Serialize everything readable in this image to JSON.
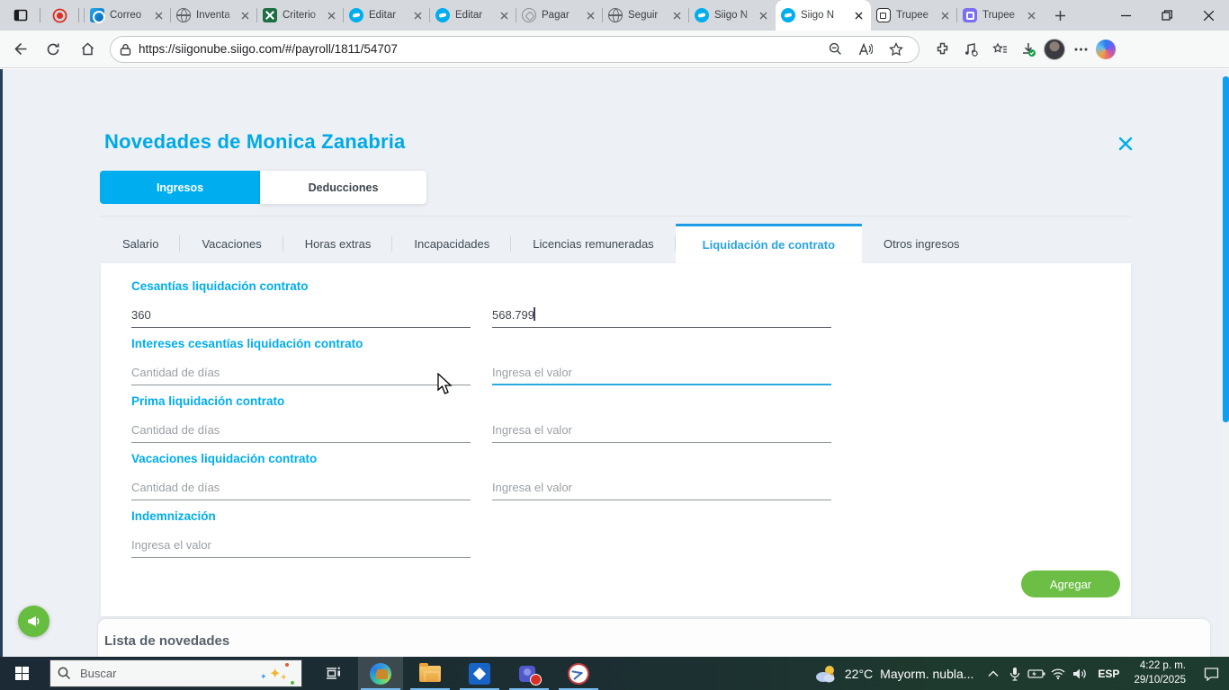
{
  "colors": {
    "accent_blue": "#00AEEF",
    "title_blue": "#00A9E6",
    "active_tab_blue": "#29a3e2",
    "green_button": "#6CBE45",
    "focus_underline": "#29ABE2",
    "taskbar_dark": "#1b2a35"
  },
  "browser": {
    "tabs": [
      {
        "label": "Correo",
        "icon": "outlook-favicon"
      },
      {
        "label": "Inventa",
        "icon": "globe-favicon"
      },
      {
        "label": "Criterio",
        "icon": "excel-favicon"
      },
      {
        "label": "Editar",
        "icon": "siigo-favicon"
      },
      {
        "label": "Editar",
        "icon": "siigo-favicon"
      },
      {
        "label": "Pagar",
        "icon": "chatgpt-favicon"
      },
      {
        "label": "Seguir",
        "icon": "globe-favicon"
      },
      {
        "label": "Siigo N",
        "icon": "siigo-favicon"
      },
      {
        "label": "Siigo N",
        "icon": "siigo-favicon",
        "active": true
      },
      {
        "label": "Trupee",
        "icon": "trupee-light-favicon"
      },
      {
        "label": "Trupee",
        "icon": "trupee-purple-favicon"
      }
    ],
    "url": "https://siigonube.siigo.com/#/payroll/1811/54707"
  },
  "modal": {
    "title": "Novedades de Monica Zanabria",
    "toggle": {
      "ingresos": "Ingresos",
      "deducciones": "Deducciones"
    },
    "tabs": [
      {
        "label": "Salario"
      },
      {
        "label": "Vacaciones"
      },
      {
        "label": "Horas extras"
      },
      {
        "label": "Incapacidades"
      },
      {
        "label": "Licencias remuneradas"
      },
      {
        "label": "Liquidación de contrato",
        "active": true
      },
      {
        "label": "Otros ingresos"
      }
    ],
    "sections": [
      {
        "label": "Cesantías liquidación contrato",
        "fields": [
          {
            "value": "360"
          },
          {
            "value": "568.799"
          }
        ]
      },
      {
        "label": "Intereses cesantías liquidación contrato",
        "fields": [
          {
            "placeholder": "Cantidad de días"
          },
          {
            "placeholder": "Ingresa el valor",
            "focused": true
          }
        ]
      },
      {
        "label": "Prima liquidación contrato",
        "fields": [
          {
            "placeholder": "Cantidad de días"
          },
          {
            "placeholder": "Ingresa el valor"
          }
        ]
      },
      {
        "label": "Vacaciones liquidación contrato",
        "fields": [
          {
            "placeholder": "Cantidad de días"
          },
          {
            "placeholder": "Ingresa el valor"
          }
        ]
      },
      {
        "label": "Indemnización",
        "fields": [
          {
            "placeholder": "Ingresa el valor"
          }
        ]
      }
    ],
    "add_button": "Agregar"
  },
  "list_section": {
    "title": "Lista de novedades"
  },
  "taskbar": {
    "search_placeholder": "Buscar",
    "weather": {
      "temp": "22°C",
      "condition": "Mayorm. nubla..."
    },
    "language": "ESP",
    "time": "4:22 p. m.",
    "date": "29/10/2025"
  }
}
